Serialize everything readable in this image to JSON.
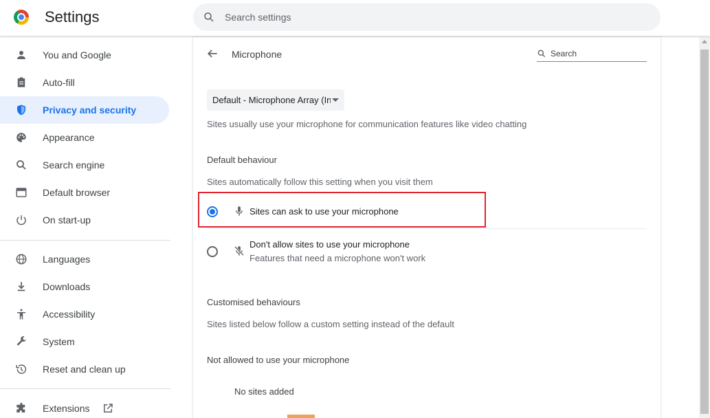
{
  "app": {
    "title": "Settings"
  },
  "search": {
    "placeholder": "Search settings"
  },
  "sidebar": {
    "items": [
      {
        "label": "You and Google",
        "icon": "person-icon"
      },
      {
        "label": "Auto-fill",
        "icon": "clipboard-icon"
      },
      {
        "label": "Privacy and security",
        "icon": "shield-icon",
        "active": true
      },
      {
        "label": "Appearance",
        "icon": "palette-icon"
      },
      {
        "label": "Search engine",
        "icon": "search-icon"
      },
      {
        "label": "Default browser",
        "icon": "browser-icon"
      },
      {
        "label": "On start-up",
        "icon": "power-icon"
      },
      {
        "label": "Languages",
        "icon": "globe-icon"
      },
      {
        "label": "Downloads",
        "icon": "download-icon"
      },
      {
        "label": "Accessibility",
        "icon": "accessibility-icon"
      },
      {
        "label": "System",
        "icon": "wrench-icon"
      },
      {
        "label": "Reset and clean up",
        "icon": "history-icon"
      },
      {
        "label": "Extensions",
        "icon": "puzzle-icon"
      }
    ]
  },
  "page": {
    "title": "Microphone",
    "search_placeholder": "Search",
    "device_select": {
      "value": "Default - Microphone Array (In"
    },
    "device_description": "Sites usually use your microphone for communication features like video chatting",
    "default_behaviour": {
      "heading": "Default behaviour",
      "description": "Sites automatically follow this setting when you visit them",
      "options": [
        {
          "label": "Sites can ask to use your microphone",
          "selected": true
        },
        {
          "label": "Don't allow sites to use your microphone",
          "sublabel": "Features that need a microphone won't work",
          "selected": false
        }
      ]
    },
    "customised": {
      "heading": "Customised behaviours",
      "description": "Sites listed below follow a custom setting instead of the default",
      "not_allowed_heading": "Not allowed to use your microphone",
      "empty_text": "No sites added"
    }
  },
  "colors": {
    "accent": "#1a73e8",
    "highlight_box": "#e0232d",
    "active_bg": "#e8f0fe"
  }
}
